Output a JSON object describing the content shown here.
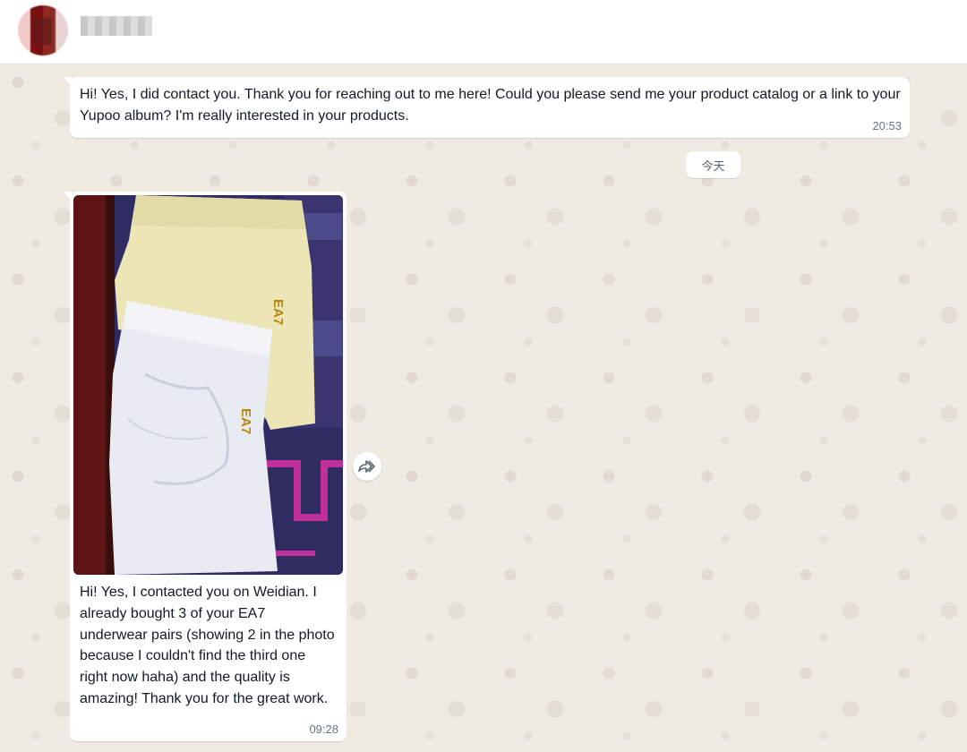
{
  "header": {
    "contact_name": "██████",
    "avatar": "avatar-blurred"
  },
  "messages": [
    {
      "text": "Hi! Yes, I did contact you. Thank you for reaching out to me here! Could you please send me your product catalog or a link to your Yupoo album? I'm really interested in your products.",
      "time": "20:53"
    },
    {
      "image_label": "EA7",
      "text": "Hi! Yes, I contacted you on Weidian. I already bought 3 of your EA7 underwear pairs (showing 2 in the photo because I couldn't find the third one right now haha) and the quality is amazing! Thank you for the great work.",
      "time": "09:28"
    }
  ],
  "date_divider": "今天",
  "icons": {
    "forward": "forward-icon"
  },
  "colors": {
    "chat_bg": "#efeae2",
    "bubble": "#ffffff",
    "timestamp": "#667781"
  }
}
